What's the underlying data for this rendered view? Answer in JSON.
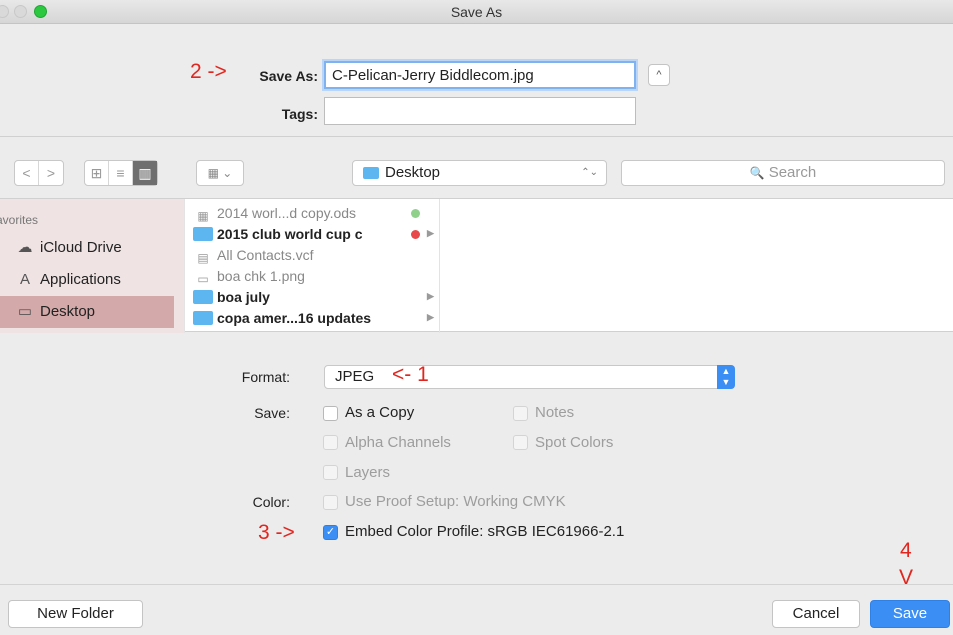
{
  "window": {
    "title": "Save As"
  },
  "top": {
    "save_as_label": "Save As:",
    "filename": "C-Pelican-Jerry Biddlecom.jpg",
    "tags_label": "Tags:",
    "tags_value": "",
    "expand_glyph": "^",
    "annotation_2": "2 ->"
  },
  "toolbar": {
    "back_glyph": "<",
    "forward_glyph": ">",
    "view_icon_glyph": "⊞",
    "view_list_glyph": "≡",
    "view_column_glyph": "▥",
    "arrange_glyph": "▦ ⌄",
    "location": "Desktop",
    "location_stepper": "⌃⌄",
    "search_placeholder": "Search",
    "search_glyph": "🔍"
  },
  "sidebar": {
    "header": "avorites",
    "items": [
      {
        "label": "iCloud Drive",
        "icon": "cloud-icon",
        "glyph": "☁"
      },
      {
        "label": "Applications",
        "icon": "applications-icon",
        "glyph": "A"
      },
      {
        "label": "Desktop",
        "icon": "desktop-icon",
        "glyph": "▭"
      }
    ]
  },
  "files": [
    {
      "name": "2014 worl...d copy.ods",
      "kind": "doc",
      "dim": true,
      "tag": "#8fd18b",
      "has_arrow": false
    },
    {
      "name": "2015 club world cup c",
      "kind": "folder",
      "dim": false,
      "tag": "#e8484a",
      "has_arrow": true
    },
    {
      "name": "All Contacts.vcf",
      "kind": "vcard",
      "dim": true,
      "tag": "",
      "has_arrow": false
    },
    {
      "name": "boa chk 1.png",
      "kind": "image",
      "dim": true,
      "tag": "",
      "has_arrow": false
    },
    {
      "name": "boa july",
      "kind": "folder",
      "dim": false,
      "tag": "",
      "has_arrow": true
    },
    {
      "name": "copa amer...16 updates",
      "kind": "folder",
      "dim": false,
      "tag": "",
      "has_arrow": true
    }
  ],
  "options": {
    "format_label": "Format:",
    "format_value": "JPEG",
    "annotation_1": "<- 1",
    "save_label": "Save:",
    "as_copy": "As a Copy",
    "notes": "Notes",
    "alpha_channels": "Alpha Channels",
    "spot_colors": "Spot Colors",
    "layers": "Layers",
    "color_label": "Color:",
    "use_proof": "Use Proof Setup:  Working CMYK",
    "embed_profile": "Embed Color Profile:  sRGB IEC61966-2.1",
    "check_glyph": "✓",
    "annotation_3": "3 ->",
    "annotation_4": "4",
    "annotation_v": "V"
  },
  "buttons": {
    "new_folder": "New Folder",
    "cancel": "Cancel",
    "save": "Save"
  },
  "colors": {
    "accent": "#3b8ef3",
    "annotation": "#e0261f",
    "sidebar_selected": "#d4a9aa"
  }
}
